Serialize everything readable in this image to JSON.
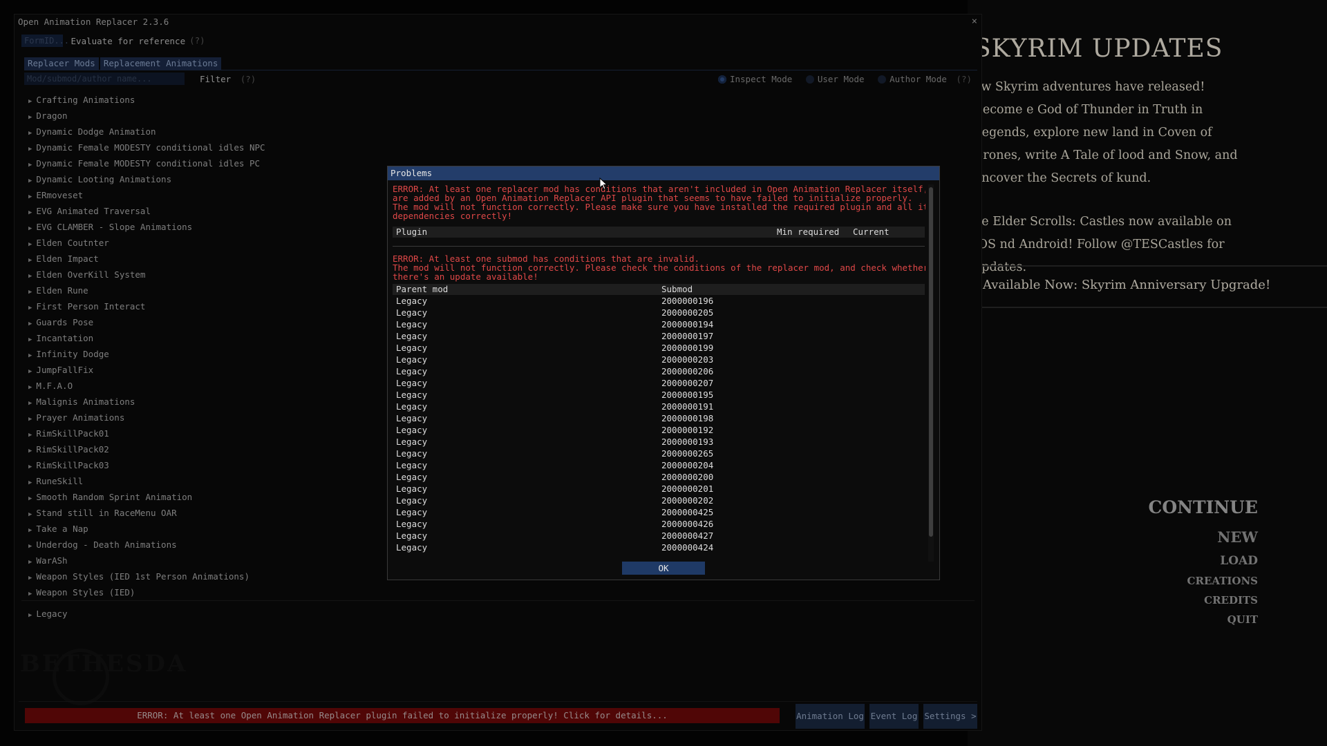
{
  "game_menu": {
    "updates_title": "SKYRIM UPDATES",
    "updates_text": "ew Skyrim adventures have released! Become e God of Thunder in Truth in Legends, explore new land in Coven of Crones, write A Tale of lood and Snow, and uncover the Secrets of kund.",
    "castles_text": "he Elder Scrolls: Castles now available on iOS nd Android! Follow @TESCastles for updates.",
    "upgrade_text": "Available Now: Skyrim Anniversary Upgrade!",
    "continue": "CONTINUE",
    "new": "NEW",
    "load": "LOAD",
    "creations": "CREATIONS",
    "credits": "CREDITS",
    "quit": "QUIT"
  },
  "window": {
    "title": "Open Animation Replacer 2.3.6",
    "close": "×"
  },
  "formid": {
    "placeholder": "FormID...",
    "label": "Evaluate for reference",
    "help": "(?)"
  },
  "tabs": [
    "Replacer Mods",
    "Replacement Animations"
  ],
  "filter": {
    "placeholder": "Mod/submod/author name...",
    "label": "Filter",
    "help": "(?)"
  },
  "modes": {
    "inspect": "Inspect Mode",
    "user": "User Mode",
    "author": "Author Mode",
    "help": "(?)",
    "selected": "Inspect Mode"
  },
  "mods": [
    "Crafting Animations",
    "Dragon",
    "Dynamic Dodge Animation",
    "Dynamic Female MODESTY conditional idles NPC",
    "Dynamic Female MODESTY conditional idles PC",
    "Dynamic Looting Animations",
    "ERmoveset",
    "EVG Animated Traversal",
    "EVG CLAMBER - Slope Animations",
    "Elden Coutnter",
    "Elden Impact",
    "Elden OverKill System",
    "Elden Rune",
    "First Person Interact",
    "Guards Pose",
    "Incantation",
    "Infinity Dodge",
    "JumpFallFix",
    "M.F.A.O",
    "Malignis Animations",
    "Prayer Animations",
    "RimSkillPack01",
    "RimSkillPack02",
    "RimSkillPack03",
    "RuneSkill",
    "Smooth Random Sprint Animation",
    "Stand still in RaceMenu OAR",
    "Take a Nap",
    "Underdog - Death Animations",
    "WarASh",
    "Weapon Styles (IED 1st Person Animations)",
    "Weapon Styles (IED)"
  ],
  "legacy_item": "Legacy",
  "status": {
    "error": "ERROR: At least one Open Animation Replacer plugin failed to initialize properly! Click for details...",
    "animation_log": "Animation Log",
    "event_log": "Event Log",
    "settings": "Settings >"
  },
  "dialog": {
    "title": "Problems",
    "error1": "ERROR: At least one replacer mod has conditions that aren't included in Open Animation Replacer itself, but\nare added by an Open Animation Replacer API plugin that seems to have failed to initialize properly.\nThe mod will not function correctly. Please make sure you have installed the required plugin and all its\ndependencies correctly!",
    "plugin_headers": [
      "Plugin",
      "Min required",
      "Current"
    ],
    "error2": "ERROR: At least one submod has conditions that are invalid.\nThe mod will not function correctly. Please check the conditions of the replacer mod, and check whether\nthere's an update available!",
    "submod_headers": [
      "Parent mod",
      "Submod"
    ],
    "submods": [
      [
        "Legacy",
        "2000000196"
      ],
      [
        "Legacy",
        "2000000205"
      ],
      [
        "Legacy",
        "2000000194"
      ],
      [
        "Legacy",
        "2000000197"
      ],
      [
        "Legacy",
        "2000000199"
      ],
      [
        "Legacy",
        "2000000203"
      ],
      [
        "Legacy",
        "2000000206"
      ],
      [
        "Legacy",
        "2000000207"
      ],
      [
        "Legacy",
        "2000000195"
      ],
      [
        "Legacy",
        "2000000191"
      ],
      [
        "Legacy",
        "2000000198"
      ],
      [
        "Legacy",
        "2000000192"
      ],
      [
        "Legacy",
        "2000000193"
      ],
      [
        "Legacy",
        "2000000265"
      ],
      [
        "Legacy",
        "2000000204"
      ],
      [
        "Legacy",
        "2000000200"
      ],
      [
        "Legacy",
        "2000000201"
      ],
      [
        "Legacy",
        "2000000202"
      ],
      [
        "Legacy",
        "2000000425"
      ],
      [
        "Legacy",
        "2000000426"
      ],
      [
        "Legacy",
        "2000000427"
      ],
      [
        "Legacy",
        "2000000424"
      ]
    ],
    "ok": "OK"
  },
  "colors": {
    "error_text": "#e04848",
    "error_bar": "#6b0808",
    "accent": "#233d6a"
  }
}
